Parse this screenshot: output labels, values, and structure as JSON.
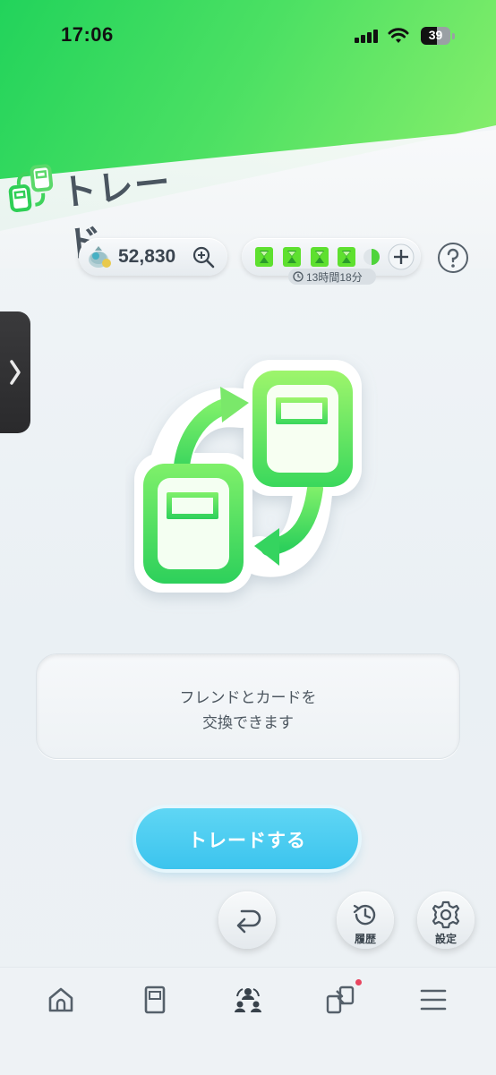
{
  "status_bar": {
    "time": "17:06",
    "battery": "39"
  },
  "header": {
    "title": "トレード"
  },
  "currency": {
    "coins": "52,830"
  },
  "stamina": {
    "timer": "13時間18分",
    "filled_count": 4
  },
  "info": {
    "line1": "フレンドとカードを",
    "line2": "交換できます"
  },
  "trade_button": {
    "label": "トレードする"
  },
  "actions": {
    "history_label": "履歴",
    "settings_label": "設定"
  },
  "bottom_nav": {
    "items": [
      {
        "icon": "home-icon"
      },
      {
        "icon": "card-binder-icon"
      },
      {
        "icon": "social-icon"
      },
      {
        "icon": "battle-icon"
      },
      {
        "icon": "menu-icon"
      }
    ]
  },
  "colors": {
    "accent_green": "#3fe060",
    "button_blue": "#48cdf1",
    "notification": "#e8455f"
  }
}
